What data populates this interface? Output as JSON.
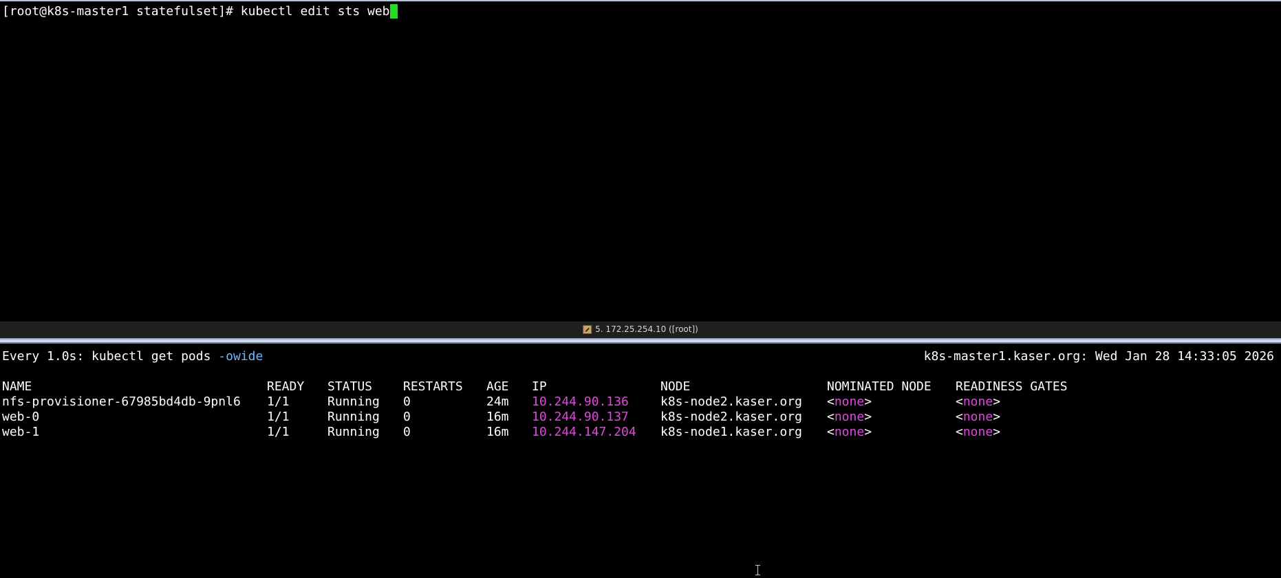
{
  "top_pane": {
    "prompt": "[root@k8s-master1 statefulset]# ",
    "command": "kubectl edit sts web"
  },
  "session_bar": {
    "icon": "tool-icon",
    "title": "5. 172.25.254.10 ([root])"
  },
  "watch_header": {
    "left_prefix": "Every 1.0s: kubectl get pods ",
    "left_flag": "-owide",
    "right": "k8s-master1.kaser.org: Wed Jan 28 14:33:05 2026"
  },
  "table": {
    "columns": [
      "NAME",
      "READY",
      "STATUS",
      "RESTARTS",
      "AGE",
      "IP",
      "NODE",
      "NOMINATED NODE",
      "READINESS GATES"
    ],
    "rows": [
      {
        "name": "nfs-provisioner-67985bd4db-9pnl6",
        "ready": "1/1",
        "status": "Running",
        "restarts": "0",
        "age": "24m",
        "ip": "10.244.90.136",
        "node": "k8s-node2.kaser.org",
        "nominated_node": "none",
        "readiness_gates": "none"
      },
      {
        "name": "web-0",
        "ready": "1/1",
        "status": "Running",
        "restarts": "0",
        "age": "16m",
        "ip": "10.244.90.137",
        "node": "k8s-node2.kaser.org",
        "nominated_node": "none",
        "readiness_gates": "none"
      },
      {
        "name": "web-1",
        "ready": "1/1",
        "status": "Running",
        "restarts": "0",
        "age": "16m",
        "ip": "10.244.147.204",
        "node": "k8s-node1.kaser.org",
        "nominated_node": "none",
        "readiness_gates": "none"
      }
    ]
  },
  "colors": {
    "background": "#000000",
    "text": "#ffffff",
    "flag": "#72b8ff",
    "highlight": "#e148e1",
    "cursor": "#22dd22"
  }
}
